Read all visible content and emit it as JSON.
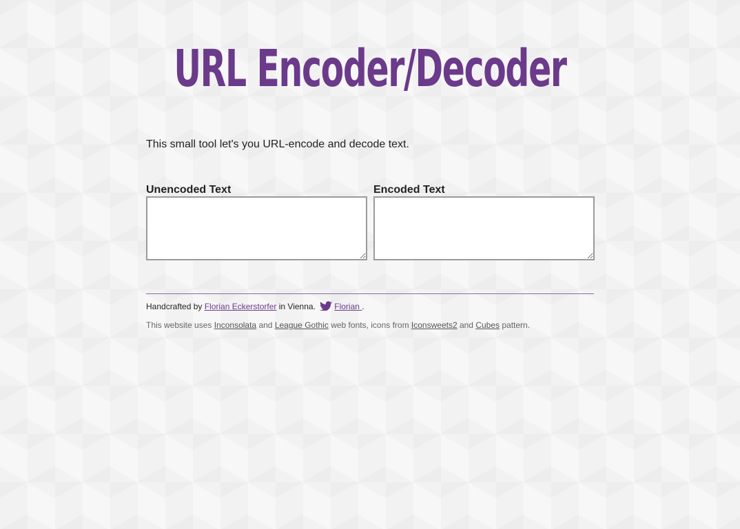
{
  "header": {
    "title": "URL Encoder/Decoder"
  },
  "intro": {
    "text": "This small tool let's you URL-encode and decode text."
  },
  "fields": {
    "unencoded": {
      "label": "Unencoded Text",
      "value": ""
    },
    "encoded": {
      "label": "Encoded Text",
      "value": ""
    }
  },
  "footer": {
    "credits": {
      "prefix": "Handcrafted by ",
      "author_link": "Florian Eckerstorfer",
      "middle": " in Vienna. ",
      "twitter_icon": "twitter-bird-icon",
      "twitter_link": "Florian ",
      "suffix": "."
    },
    "fonts_note": {
      "t1": "This website uses ",
      "link1": "Inconsolata",
      "t2": " and ",
      "link2": "League Gothic",
      "t3": " web fonts, icons from ",
      "link3": "Iconsweets2",
      "t4": " and ",
      "link4": "Cubes",
      "t5": " pattern."
    }
  },
  "colors": {
    "accent": "#6b3a8a",
    "background": "#f2f2f2",
    "text": "#222222",
    "muted_text": "#666666"
  }
}
